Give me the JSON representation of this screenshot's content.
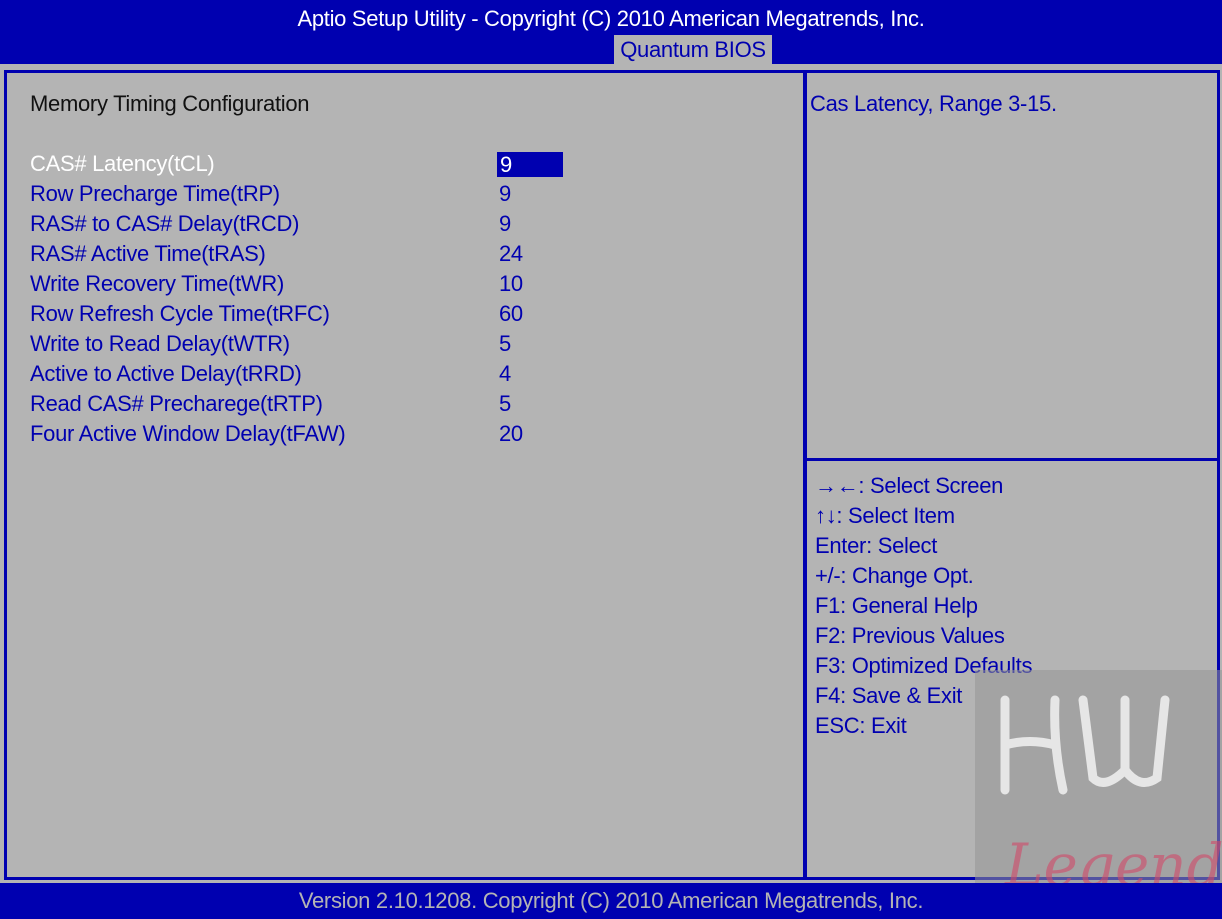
{
  "header": {
    "title": "Aptio Setup Utility - Copyright (C) 2010 American Megatrends, Inc.",
    "tab": "Quantum BIOS"
  },
  "main": {
    "section_title": "Memory Timing Configuration",
    "items": [
      {
        "label": "CAS# Latency(tCL)",
        "value": "9",
        "selected": true
      },
      {
        "label": "Row Precharge Time(tRP)",
        "value": "9"
      },
      {
        "label": "RAS# to CAS# Delay(tRCD)",
        "value": "9"
      },
      {
        "label": "RAS# Active Time(tRAS)",
        "value": "24"
      },
      {
        "label": "Write Recovery Time(tWR)",
        "value": "10"
      },
      {
        "label": "Row Refresh Cycle Time(tRFC)",
        "value": "60"
      },
      {
        "label": "Write to Read Delay(tWTR)",
        "value": "5"
      },
      {
        "label": "Active to Active Delay(tRRD)",
        "value": "4"
      },
      {
        "label": "Read CAS# Precharege(tRTP)",
        "value": "5"
      },
      {
        "label": "Four Active Window Delay(tFAW)",
        "value": "20"
      }
    ]
  },
  "help": {
    "text": "Cas Latency, Range 3-15."
  },
  "keys": [
    {
      "glyph": "→←",
      "text": ": Select Screen"
    },
    {
      "glyph": "↑↓",
      "text": ": Select Item"
    },
    {
      "glyph": "",
      "text": "Enter: Select"
    },
    {
      "glyph": "",
      "text": "+/-: Change Opt."
    },
    {
      "glyph": "",
      "text": "F1: General Help"
    },
    {
      "glyph": "",
      "text": "F2: Previous Values"
    },
    {
      "glyph": "",
      "text": "F3: Optimized Defaults"
    },
    {
      "glyph": "",
      "text": "F4: Save & Exit"
    },
    {
      "glyph": "",
      "text": "ESC: Exit"
    }
  ],
  "footer": {
    "version": "Version 2.10.1208. Copyright (C) 2010 American Megatrends, Inc."
  },
  "watermark": {
    "line1": "HW",
    "line2": "Legend"
  },
  "colors": {
    "bios_blue": "#0000b0",
    "panel_gray": "#b4b4b4",
    "watermark_pink": "#d04a6a"
  }
}
